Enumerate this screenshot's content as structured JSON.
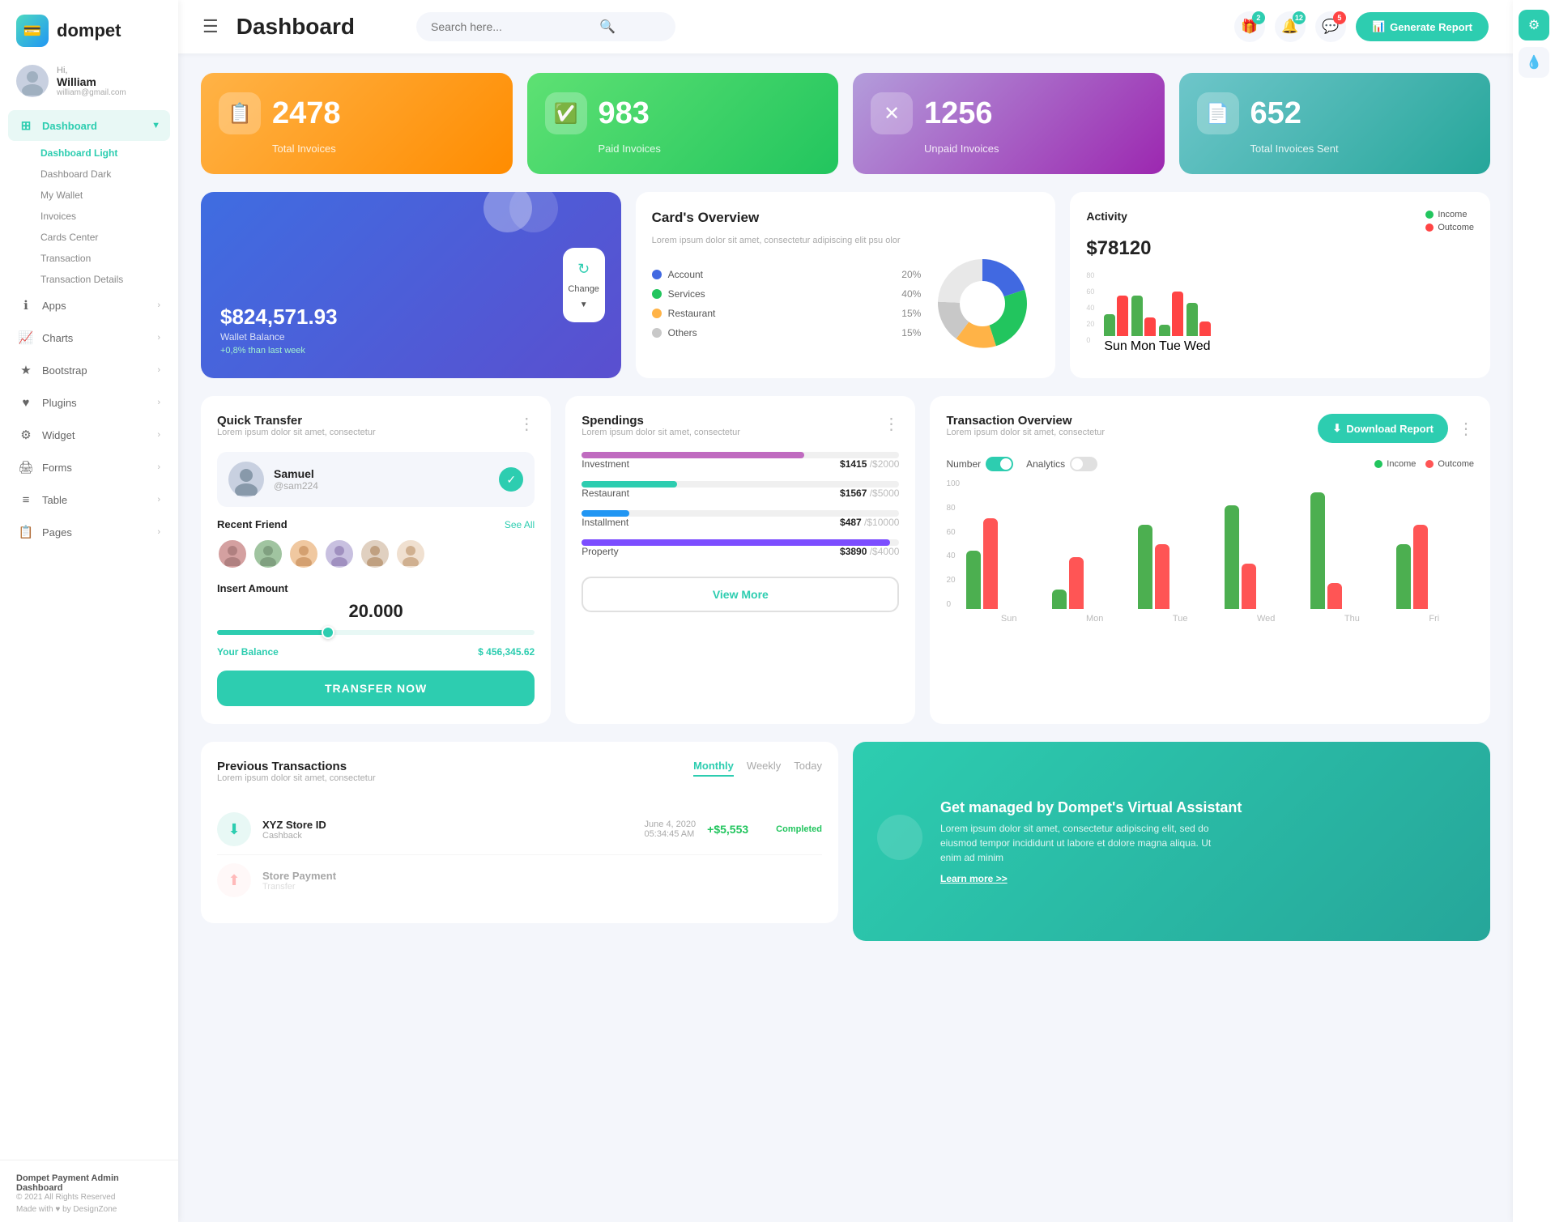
{
  "brand": {
    "name": "dompet",
    "logo_icon": "💳"
  },
  "user": {
    "greeting": "Hi, William",
    "email": "william@gmail.com",
    "avatar": "👤"
  },
  "header": {
    "title": "Dashboard",
    "search_placeholder": "Search here...",
    "generate_btn": "Generate Report",
    "hamburger": "☰",
    "notif_bell_count": "12",
    "notif_chat_count": "5",
    "notif_gift_count": "2"
  },
  "sidebar": {
    "nav_items": [
      {
        "label": "Dashboard",
        "icon": "⊞",
        "active": true,
        "has_sub": true
      },
      {
        "label": "Apps",
        "icon": "ℹ",
        "active": false,
        "has_sub": true
      },
      {
        "label": "Charts",
        "icon": "📈",
        "active": false,
        "has_sub": true
      },
      {
        "label": "Bootstrap",
        "icon": "★",
        "active": false,
        "has_sub": true
      },
      {
        "label": "Plugins",
        "icon": "♥",
        "active": false,
        "has_sub": true
      },
      {
        "label": "Widget",
        "icon": "⚙",
        "active": false,
        "has_sub": true
      },
      {
        "label": "Forms",
        "icon": "🖨",
        "active": false,
        "has_sub": true
      },
      {
        "label": "Table",
        "icon": "≡",
        "active": false,
        "has_sub": true
      },
      {
        "label": "Pages",
        "icon": "📋",
        "active": false,
        "has_sub": true
      }
    ],
    "sub_items": [
      {
        "label": "Dashboard Light",
        "active": true
      },
      {
        "label": "Dashboard Dark",
        "active": false
      },
      {
        "label": "My Wallet",
        "active": false
      },
      {
        "label": "Invoices",
        "active": false
      },
      {
        "label": "Cards Center",
        "active": false
      },
      {
        "label": "Transaction",
        "active": false
      },
      {
        "label": "Transaction Details",
        "active": false
      }
    ],
    "footer_brand": "Dompet Payment Admin Dashboard",
    "footer_copy": "© 2021 All Rights Reserved",
    "footer_made": "Made with ♥ by DesignZone"
  },
  "stat_cards": [
    {
      "num": "2478",
      "label": "Total Invoices",
      "color": "orange",
      "icon": "📋"
    },
    {
      "num": "983",
      "label": "Paid Invoices",
      "color": "green",
      "icon": "✅"
    },
    {
      "num": "1256",
      "label": "Unpaid Invoices",
      "color": "purple",
      "icon": "✕"
    },
    {
      "num": "652",
      "label": "Total Invoices Sent",
      "color": "teal",
      "icon": "📄"
    }
  ],
  "wallet": {
    "circles_icon": "●●",
    "amount": "$824,571.93",
    "label": "Wallet Balance",
    "change": "+0,8% than last week",
    "btn_label": "Change"
  },
  "cards_overview": {
    "title": "Card's Overview",
    "subtitle": "Lorem ipsum dolor sit amet, consectetur adipiscing elit psu olor",
    "items": [
      {
        "name": "Account",
        "pct": "20%",
        "color": "#4169e1"
      },
      {
        "name": "Services",
        "pct": "40%",
        "color": "#22C55E"
      },
      {
        "name": "Restaurant",
        "pct": "15%",
        "color": "#FFB347"
      },
      {
        "name": "Others",
        "pct": "15%",
        "color": "#c8c8c8"
      }
    ]
  },
  "activity": {
    "title": "Activity",
    "amount": "$78120",
    "legend": [
      {
        "label": "Income",
        "color": "#22C55E"
      },
      {
        "label": "Outcome",
        "color": "#f44"
      }
    ],
    "bars": {
      "groups": [
        "Sun",
        "Mon",
        "Tue",
        "Wed"
      ],
      "income": [
        30,
        55,
        15,
        45
      ],
      "outcome": [
        55,
        25,
        60,
        20
      ]
    },
    "y_labels": [
      "0",
      "20",
      "40",
      "60",
      "80"
    ]
  },
  "quick_transfer": {
    "title": "Quick Transfer",
    "subtitle": "Lorem ipsum dolor sit amet, consectetur",
    "selected_friend": {
      "name": "Samuel",
      "handle": "@sam224",
      "avatar": "👨"
    },
    "recent_label": "Recent Friend",
    "see_all": "See All",
    "friends": [
      "👩",
      "👩🏾",
      "👧",
      "👩🏻",
      "👩🏼",
      "👱‍♀️"
    ],
    "amount_label": "Insert Amount",
    "amount_val": "20.000",
    "balance_label": "Your Balance",
    "balance_val": "$ 456,345.62",
    "transfer_btn": "TRANSFER NOW"
  },
  "spendings": {
    "title": "Spendings",
    "subtitle": "Lorem ipsum dolor sit amet, consectetur",
    "items": [
      {
        "name": "Investment",
        "val": "$1415",
        "max": "/$2000",
        "pct": 70,
        "color": "#c06bc0"
      },
      {
        "name": "Restaurant",
        "val": "$1567",
        "max": "/$5000",
        "pct": 30,
        "color": "#2dcdb0"
      },
      {
        "name": "Installment",
        "val": "$487",
        "max": "/$10000",
        "pct": 15,
        "color": "#2196F3"
      },
      {
        "name": "Property",
        "val": "$3890",
        "max": "/$4000",
        "pct": 97,
        "color": "#7c4dff"
      }
    ],
    "view_more": "View More"
  },
  "tx_overview": {
    "title": "Transaction Overview",
    "subtitle": "Lorem ipsum dolor sit amet, consectetur",
    "download_btn": "Download Report",
    "toggle_number": "Number",
    "toggle_analytics": "Analytics",
    "legend": [
      {
        "label": "Income",
        "color": "#22C55E"
      },
      {
        "label": "Outcome",
        "color": "#f55"
      }
    ],
    "bars": {
      "groups": [
        "Sun",
        "Mon",
        "Tue",
        "Wed",
        "Thu",
        "Fri"
      ],
      "income": [
        45,
        15,
        65,
        80,
        90,
        50
      ],
      "outcome": [
        70,
        40,
        50,
        35,
        20,
        65
      ]
    },
    "y_labels": [
      "0",
      "20",
      "40",
      "60",
      "80",
      "100"
    ]
  },
  "prev_transactions": {
    "title": "Previous Transactions",
    "subtitle": "Lorem ipsum dolor sit amet, consectetur",
    "tabs": [
      "Monthly",
      "Weekly",
      "Today"
    ],
    "active_tab": "Monthly",
    "rows": [
      {
        "icon": "⬇",
        "name": "XYZ Store ID",
        "type": "Cashback",
        "date": "June 4, 2020",
        "time": "05:34:45 AM",
        "amount": "+$5,553",
        "status": "Completed"
      }
    ]
  },
  "va_banner": {
    "icon": "💰",
    "title": "Get managed by Dompet's Virtual Assistant",
    "desc": "Lorem ipsum dolor sit amet, consectetur adipiscing elit, sed do eiusmod tempor incididunt ut labore et dolore magna aliqua. Ut enim ad minim",
    "learn": "Learn more >>"
  },
  "right_panel": {
    "settings_icon": "⚙",
    "water_icon": "💧"
  }
}
